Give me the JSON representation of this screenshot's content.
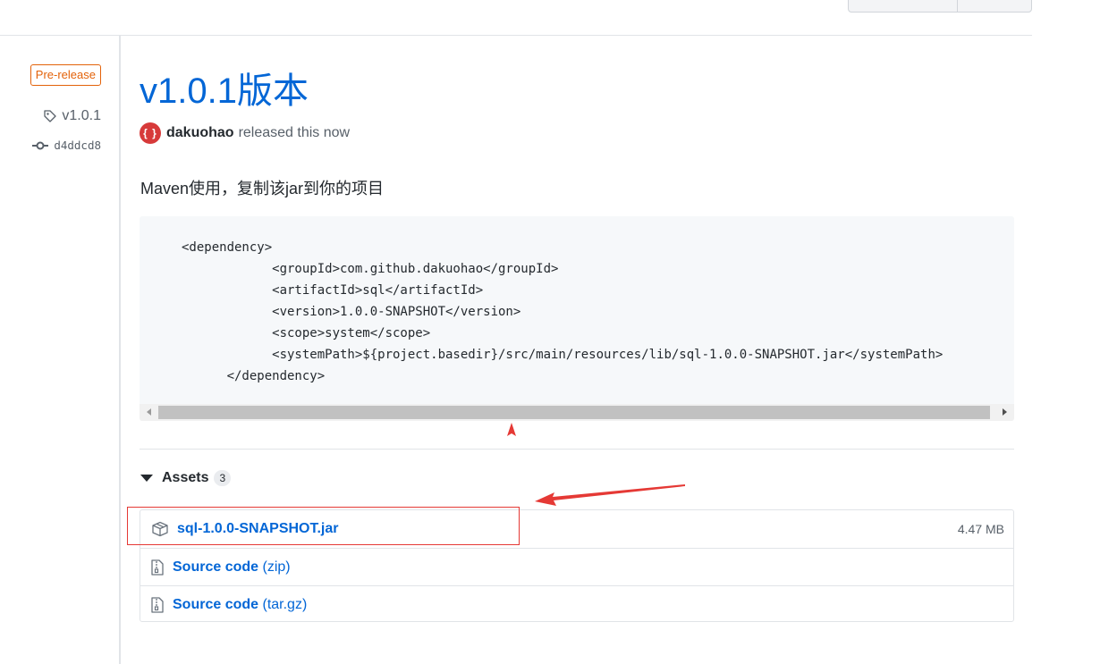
{
  "release": {
    "badge": "Pre-release",
    "tag": "v1.0.1",
    "commit": "d4ddcd8",
    "title": "v1.0.1版本",
    "avatar_text": "{ }",
    "author": "dakuohao",
    "released_text": "released this now",
    "description": "Maven使用，复制该jar到你的项目",
    "code": "<dependency>\n            <groupId>com.github.dakuohao</groupId>\n            <artifactId>sql</artifactId>\n            <version>1.0.0-SNAPSHOT</version>\n            <scope>system</scope>\n            <systemPath>${project.basedir}/src/main/resources/lib/sql-1.0.0-SNAPSHOT.jar</systemPath>\n      </dependency>"
  },
  "assets": {
    "label": "Assets",
    "count": "3",
    "items": [
      {
        "name": "sql-1.0.0-SNAPSHOT.jar",
        "suffix": "",
        "size": "4.47 MB",
        "icon": "package-icon"
      },
      {
        "name": "Source code",
        "suffix": "(zip)",
        "size": "",
        "icon": "file-zip-icon"
      },
      {
        "name": "Source code",
        "suffix": "(tar.gz)",
        "size": "",
        "icon": "file-zip-icon"
      }
    ]
  },
  "colors": {
    "link": "#0366d6",
    "prerelease": "#e36209",
    "annotation": "#e53935",
    "avatar": "#d73a3a"
  }
}
